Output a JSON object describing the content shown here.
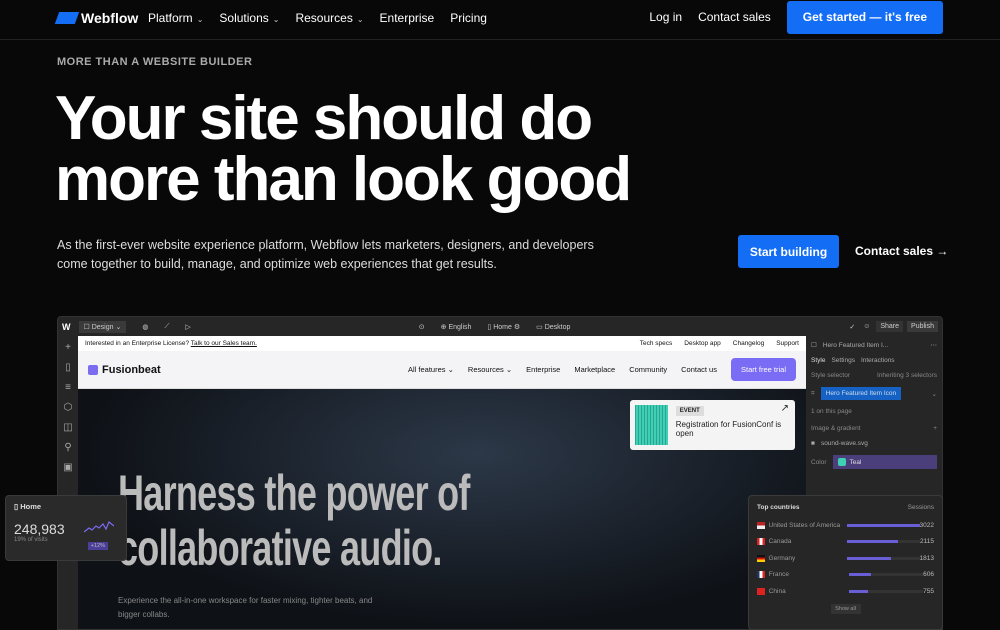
{
  "nav": {
    "brand": "Webflow",
    "links": [
      {
        "label": "Platform",
        "dropdown": true
      },
      {
        "label": "Solutions",
        "dropdown": true
      },
      {
        "label": "Resources",
        "dropdown": true
      },
      {
        "label": "Enterprise"
      },
      {
        "label": "Pricing"
      }
    ],
    "login": "Log in",
    "contact": "Contact sales",
    "cta": "Get started — it's free"
  },
  "hero": {
    "eyebrow": "MORE THAN A WEBSITE BUILDER",
    "title_line1": "Your site should do",
    "title_line2": "more than look good",
    "lead": "As the first-ever website experience platform, Webflow lets marketers, designers, and developers come together to build, manage, and optimize web experiences that get results.",
    "primary": "Start building",
    "secondary": "Contact sales →"
  },
  "designer": {
    "mode": "Design",
    "locale": "English",
    "page": "Home",
    "breakpoint": "Desktop",
    "share": "Share",
    "publish": "Publish",
    "site": {
      "banner": "Interested in an Enterprise License?",
      "banner_link": "Talk to our Sales team.",
      "util_links": [
        "Tech specs",
        "Desktop app",
        "Changelog",
        "Support"
      ],
      "brand": "Fusionbeat",
      "links": [
        "All features",
        "Resources",
        "Enterprise",
        "Marketplace",
        "Community",
        "Contact us"
      ],
      "cta": "Start free trial",
      "event_tag": "EVENT",
      "event_text": "Registration for FusionConf is open",
      "headline1": "Harness the power of",
      "headline2": "collaborative audio.",
      "sub": "Experience the all-in-one workspace for faster mixing, tighter beats, and bigger collabs."
    },
    "panel": {
      "element": "Hero Featured Item I...",
      "tabs": [
        "Style",
        "Settings",
        "Interactions"
      ],
      "style_selector": "Style selector",
      "inheriting": "Inheriting 3 selectors",
      "class": "Hero Featured Item Icon",
      "on_page": "1 on this page",
      "image_gradient": "Image & gradient",
      "file": "sound-wave.svg",
      "color_label": "Color",
      "color_value": "Teal"
    }
  },
  "home_card": {
    "title": "Home",
    "value": "248,983",
    "sub": "19% of visits",
    "badge": "+12%"
  },
  "countries": {
    "title": "Top countries",
    "col": "Sessions",
    "show_all": "Show all",
    "rows": [
      {
        "name": "United States of America",
        "value": "3022",
        "bar": 1.0
      },
      {
        "name": "Canada",
        "value": "2115",
        "bar": 0.7
      },
      {
        "name": "Germany",
        "value": "1813",
        "bar": 0.6
      },
      {
        "name": "France",
        "value": "606",
        "bar": 0.3
      },
      {
        "name": "China",
        "value": "755",
        "bar": 0.25
      }
    ]
  },
  "colors": {
    "accent": "#146ef5",
    "purple": "#7b6cf6",
    "teal": "#3fcfb5"
  }
}
